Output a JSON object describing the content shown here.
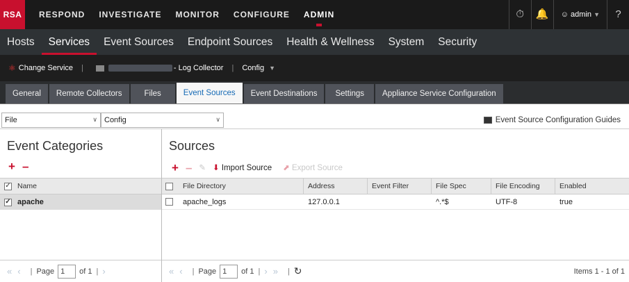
{
  "brand": {
    "logo": "RSA"
  },
  "topnav": {
    "items": [
      "RESPOND",
      "INVESTIGATE",
      "MONITOR",
      "CONFIGURE",
      "ADMIN"
    ],
    "active": "ADMIN",
    "user": "admin",
    "icons": [
      "timer-icon",
      "bell-icon",
      "user-icon",
      "help-icon"
    ]
  },
  "subnav": {
    "items": [
      "Hosts",
      "Services",
      "Event Sources",
      "Endpoint Sources",
      "Health & Wellness",
      "System",
      "Security"
    ],
    "active": "Services"
  },
  "servicebar": {
    "change_service": "Change Service",
    "service_suffix": "- Log Collector",
    "config": "Config"
  },
  "tabs": {
    "items": [
      "General",
      "Remote Collectors",
      "Files",
      "Event Sources",
      "Event Destinations",
      "Settings",
      "Appliance Service Configuration"
    ],
    "active": "Event Sources"
  },
  "filters": {
    "type_value": "File",
    "mode_value": "Config",
    "guides_label": "Event Source Configuration Guides"
  },
  "categories": {
    "title": "Event Categories",
    "header_name": "Name",
    "rows": [
      {
        "name": "apache",
        "checked": true
      }
    ],
    "pager": {
      "page_label": "Page",
      "page": "1",
      "of": "of 1"
    }
  },
  "sources": {
    "title": "Sources",
    "import_label": "Import Source",
    "export_label": "Export Source",
    "columns": [
      "File Directory",
      "Address",
      "Event Filter",
      "File Spec",
      "File Encoding",
      "Enabled"
    ],
    "rows": [
      {
        "file_directory": "apache_logs",
        "address": "127.0.0.1",
        "event_filter": "",
        "file_spec": "^.*$",
        "file_encoding": "UTF-8",
        "enabled": "true"
      }
    ],
    "pager": {
      "page_label": "Page",
      "page": "1",
      "of": "of 1",
      "items": "Items 1 - 1 of 1"
    }
  },
  "colors": {
    "accent": "#c8102e",
    "active_tab_text": "#1469b5",
    "topbar": "#1a1a1a"
  }
}
